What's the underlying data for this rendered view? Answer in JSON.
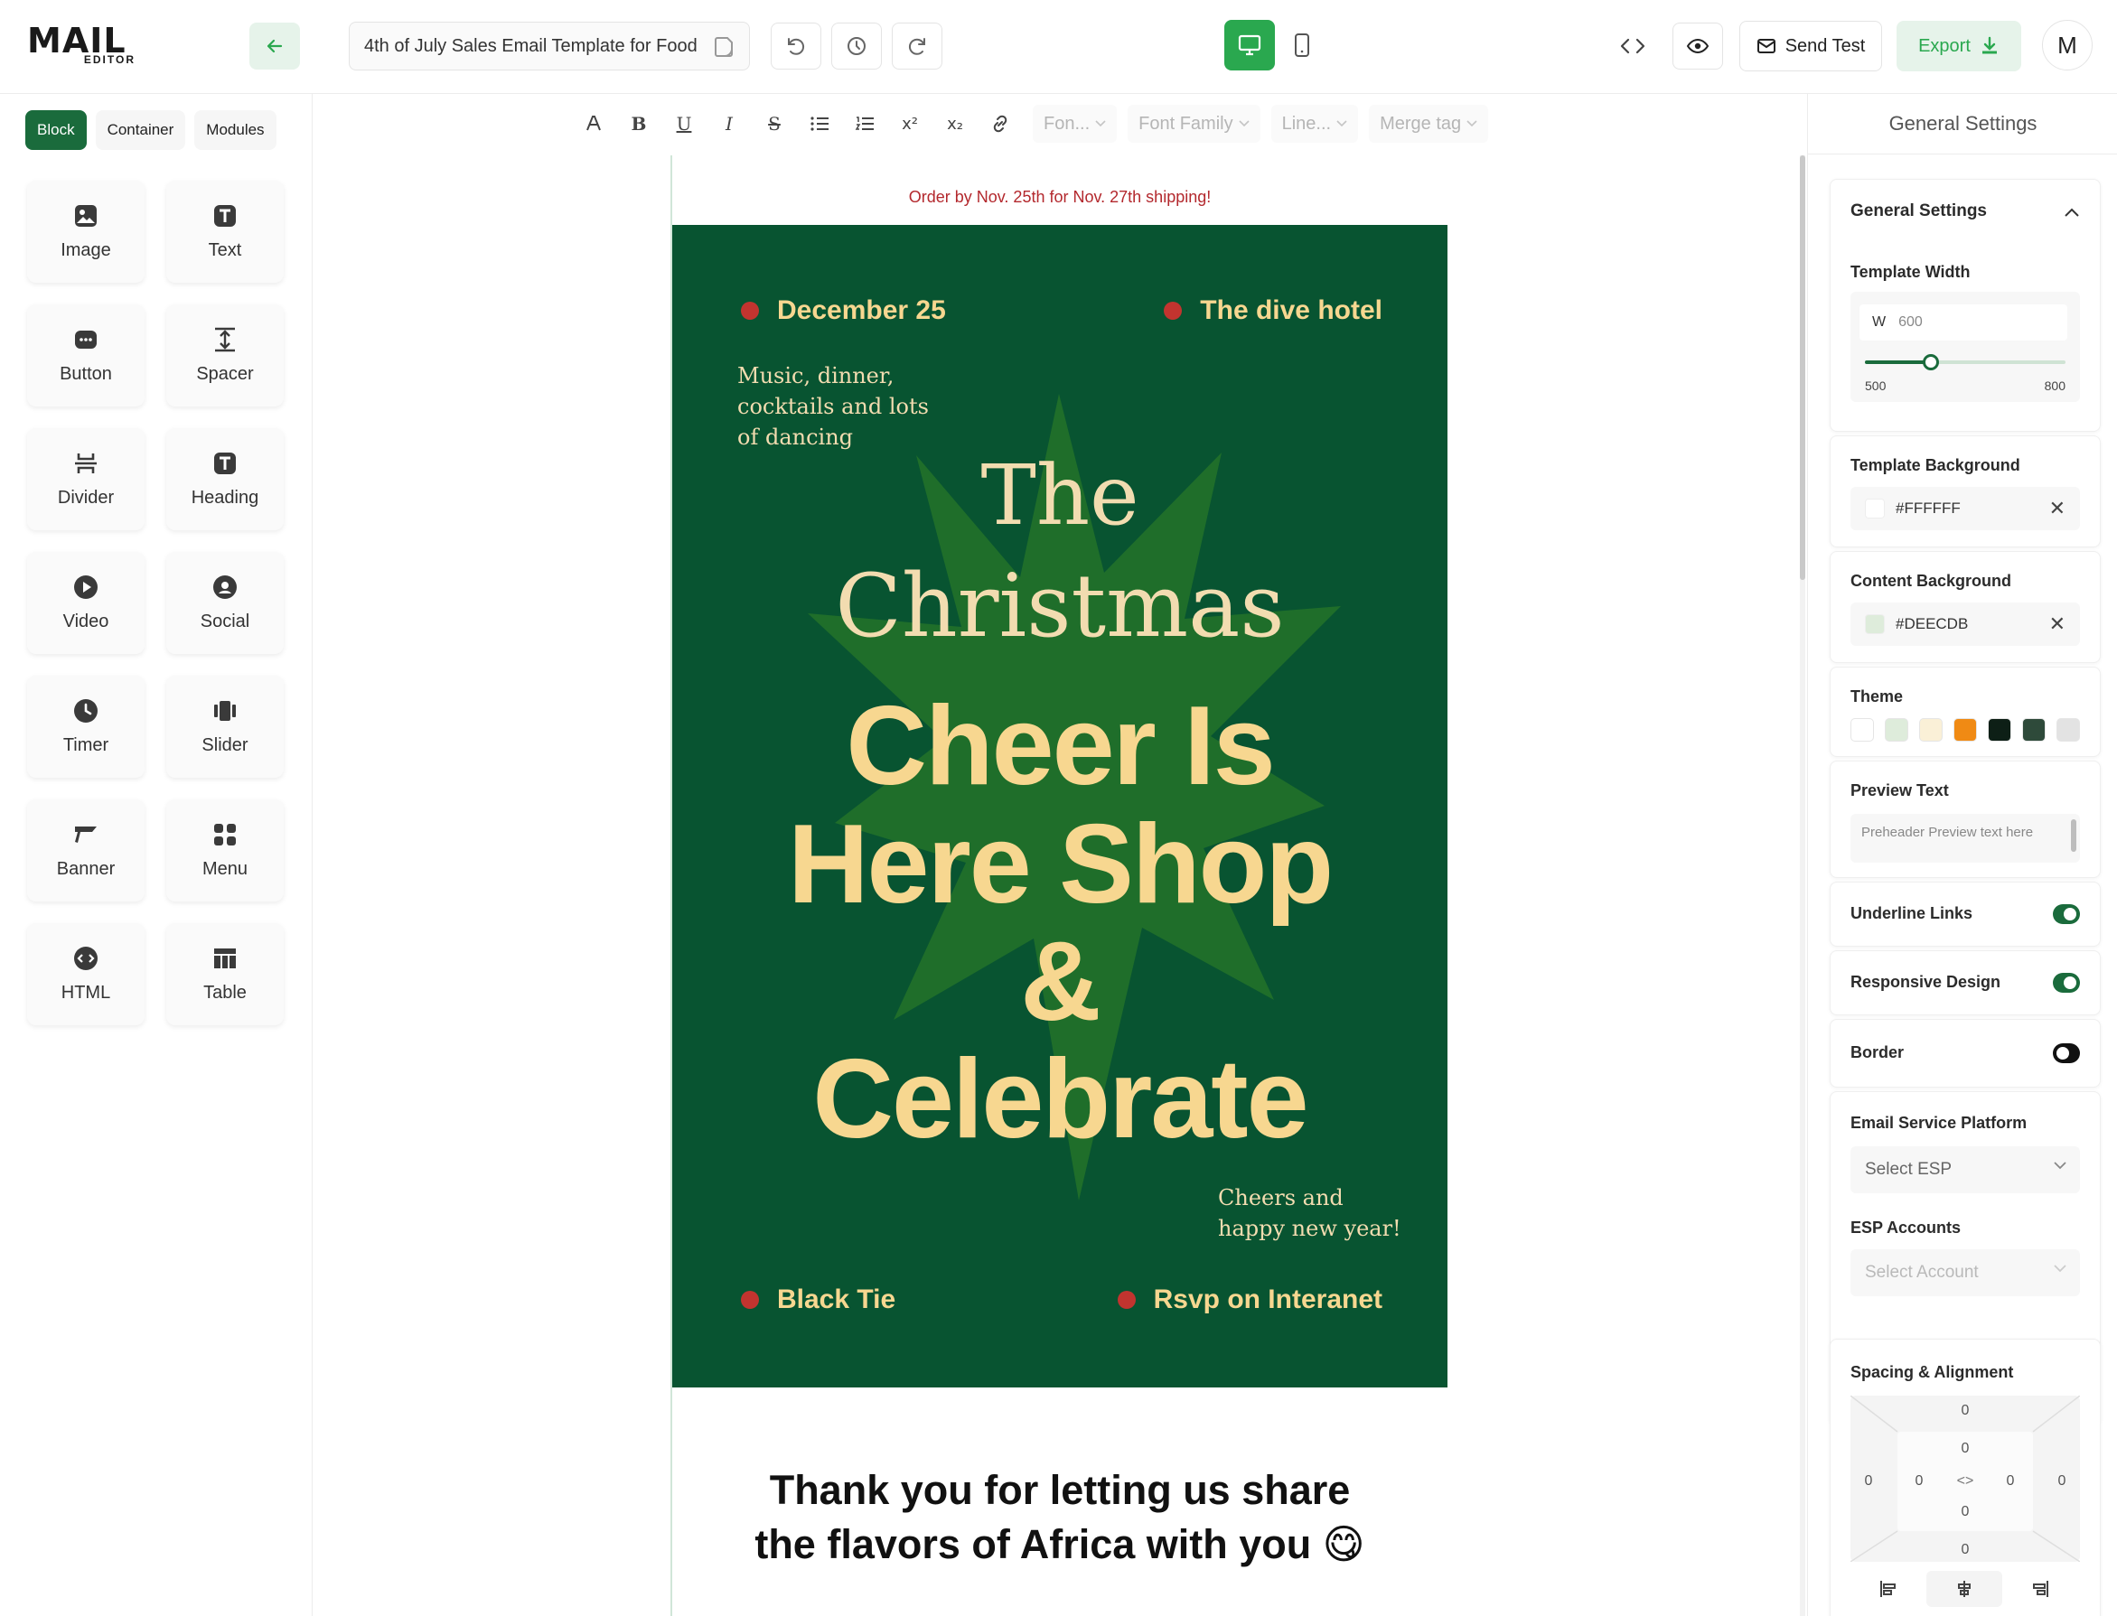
{
  "app": {
    "logo_main": "MAIL",
    "logo_sub": "EDITOR",
    "template_title": "4th of July Sales Email Template for Food",
    "send_test_label": "Send Test",
    "export_label": "Export",
    "avatar_initial": "M"
  },
  "left_tabs": [
    "Block",
    "Container",
    "Modules"
  ],
  "blocks": [
    {
      "label": "Image",
      "icon": "image-icon"
    },
    {
      "label": "Text",
      "icon": "text-icon"
    },
    {
      "label": "Button",
      "icon": "button-icon"
    },
    {
      "label": "Spacer",
      "icon": "spacer-icon"
    },
    {
      "label": "Divider",
      "icon": "divider-icon"
    },
    {
      "label": "Heading",
      "icon": "heading-icon"
    },
    {
      "label": "Video",
      "icon": "video-icon"
    },
    {
      "label": "Social",
      "icon": "social-icon"
    },
    {
      "label": "Timer",
      "icon": "timer-icon"
    },
    {
      "label": "Slider",
      "icon": "slider-icon"
    },
    {
      "label": "Banner",
      "icon": "banner-icon"
    },
    {
      "label": "Menu",
      "icon": "menu-icon"
    },
    {
      "label": "HTML",
      "icon": "html-icon"
    },
    {
      "label": "Table",
      "icon": "table-icon"
    }
  ],
  "toolbar": {
    "bold": "B",
    "underline": "U",
    "italic": "I",
    "strike": "S",
    "superscript": "x²",
    "subscript": "x₂",
    "font_size_placeholder": "Fon...",
    "font_family_placeholder": "Font Family",
    "line_height_placeholder": "Line...",
    "merge_tag_placeholder": "Merge tag"
  },
  "email": {
    "preheader": "Order by Nov. 25th for Nov. 27th shipping!",
    "date": "December 25",
    "venue": "The dive hotel",
    "note_top": [
      "Music, dinner,",
      "cocktails and lots",
      "of dancing"
    ],
    "script_line1": "The",
    "script_line2": "Christmas",
    "headline_lines": [
      "Cheer Is",
      "Here Shop",
      "&",
      "Celebrate"
    ],
    "note_bottom": [
      "Cheers and",
      "happy new year!"
    ],
    "dress_code": "Black Tie",
    "rsvp": "Rsvp on Interanet",
    "thanks_line1": "Thank you for letting us share",
    "thanks_line2": "the flavors of Africa with you 😋",
    "colors": {
      "hero_bg": "#085431",
      "star": "#1f6e2a",
      "headline": "#f7d790",
      "accent_dot": "#c2342f"
    }
  },
  "settings": {
    "panel_title": "General Settings",
    "section_title": "General Settings",
    "template_width_label": "Template Width",
    "width_prefix": "W",
    "width_value": "600",
    "width_min": "500",
    "width_max": "800",
    "width_slider_fraction": 0.33,
    "template_bg_label": "Template Background",
    "template_bg_value": "#FFFFFF",
    "content_bg_label": "Content Background",
    "content_bg_value": "#DEECDB",
    "theme_label": "Theme",
    "theme_colors": [
      "#ffffff",
      "#deecdb",
      "#faf0d7",
      "#f08a14",
      "#0d1f16",
      "#2e4a3a",
      "#e3e3e3"
    ],
    "preview_text_label": "Preview Text",
    "preview_text_placeholder": "Preheader Preview text here",
    "underline_links_label": "Underline Links",
    "underline_links_on": true,
    "responsive_label": "Responsive Design",
    "responsive_on": true,
    "border_label": "Border",
    "border_on": false,
    "esp_label": "Email Service Platform",
    "esp_placeholder": "Select ESP",
    "esp_accounts_label": "ESP Accounts",
    "esp_accounts_placeholder": "Select Account",
    "spacing_label": "Spacing & Alignment",
    "spacing_values": {
      "margin_top": "0",
      "padding_top": "0",
      "padding_bottom": "0",
      "margin_bottom": "0",
      "margin_left": "0",
      "padding_left": "0",
      "padding_right": "0",
      "margin_right": "0"
    }
  }
}
